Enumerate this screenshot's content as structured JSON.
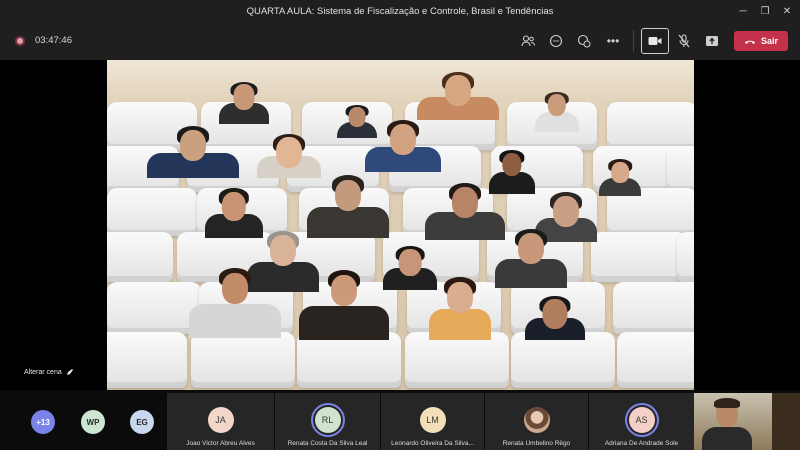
{
  "window": {
    "title": "QUARTA AULA: Sistema de Fiscalização e Controle, Brasil e Tendências",
    "minimize": "─",
    "maximize": "❐",
    "close": "✕"
  },
  "toolbar": {
    "timer": "03:47:46",
    "icons": [
      "participants-icon",
      "chat-icon",
      "reactions-icon",
      "more-options-icon",
      "camera-icon",
      "mic-off-icon",
      "share-icon"
    ],
    "more_label": "•••",
    "leave_label": "Sair",
    "leave_color": "#c4314b"
  },
  "stage": {
    "change_scene_label": "Alterar cena"
  },
  "participants_bar": {
    "overflow_count": "+13",
    "small_avatars": [
      {
        "initials": "WP",
        "color": "#cde6d3"
      },
      {
        "initials": "EG",
        "color": "#c7d8ee"
      }
    ],
    "tiles": [
      {
        "initials": "JA",
        "name": "Joao Victor Abreu Alves",
        "color": "#f2d7c9",
        "speaking": false
      },
      {
        "initials": "RL",
        "name": "Renata Costa Da Silva Leal",
        "color": "#cfe3cf",
        "speaking": true
      },
      {
        "initials": "LM",
        "name": "Leonardo Oliveira Da Silva...",
        "color": "#f3e0b8",
        "speaking": false
      },
      {
        "initials": "",
        "name": "Renata Umbelino Rêgo",
        "color": "#e8c9b4",
        "speaking": false
      },
      {
        "initials": "AS",
        "name": "Adriana De Andrade Sole",
        "color": "#f2d0c8",
        "speaking": true
      }
    ]
  }
}
